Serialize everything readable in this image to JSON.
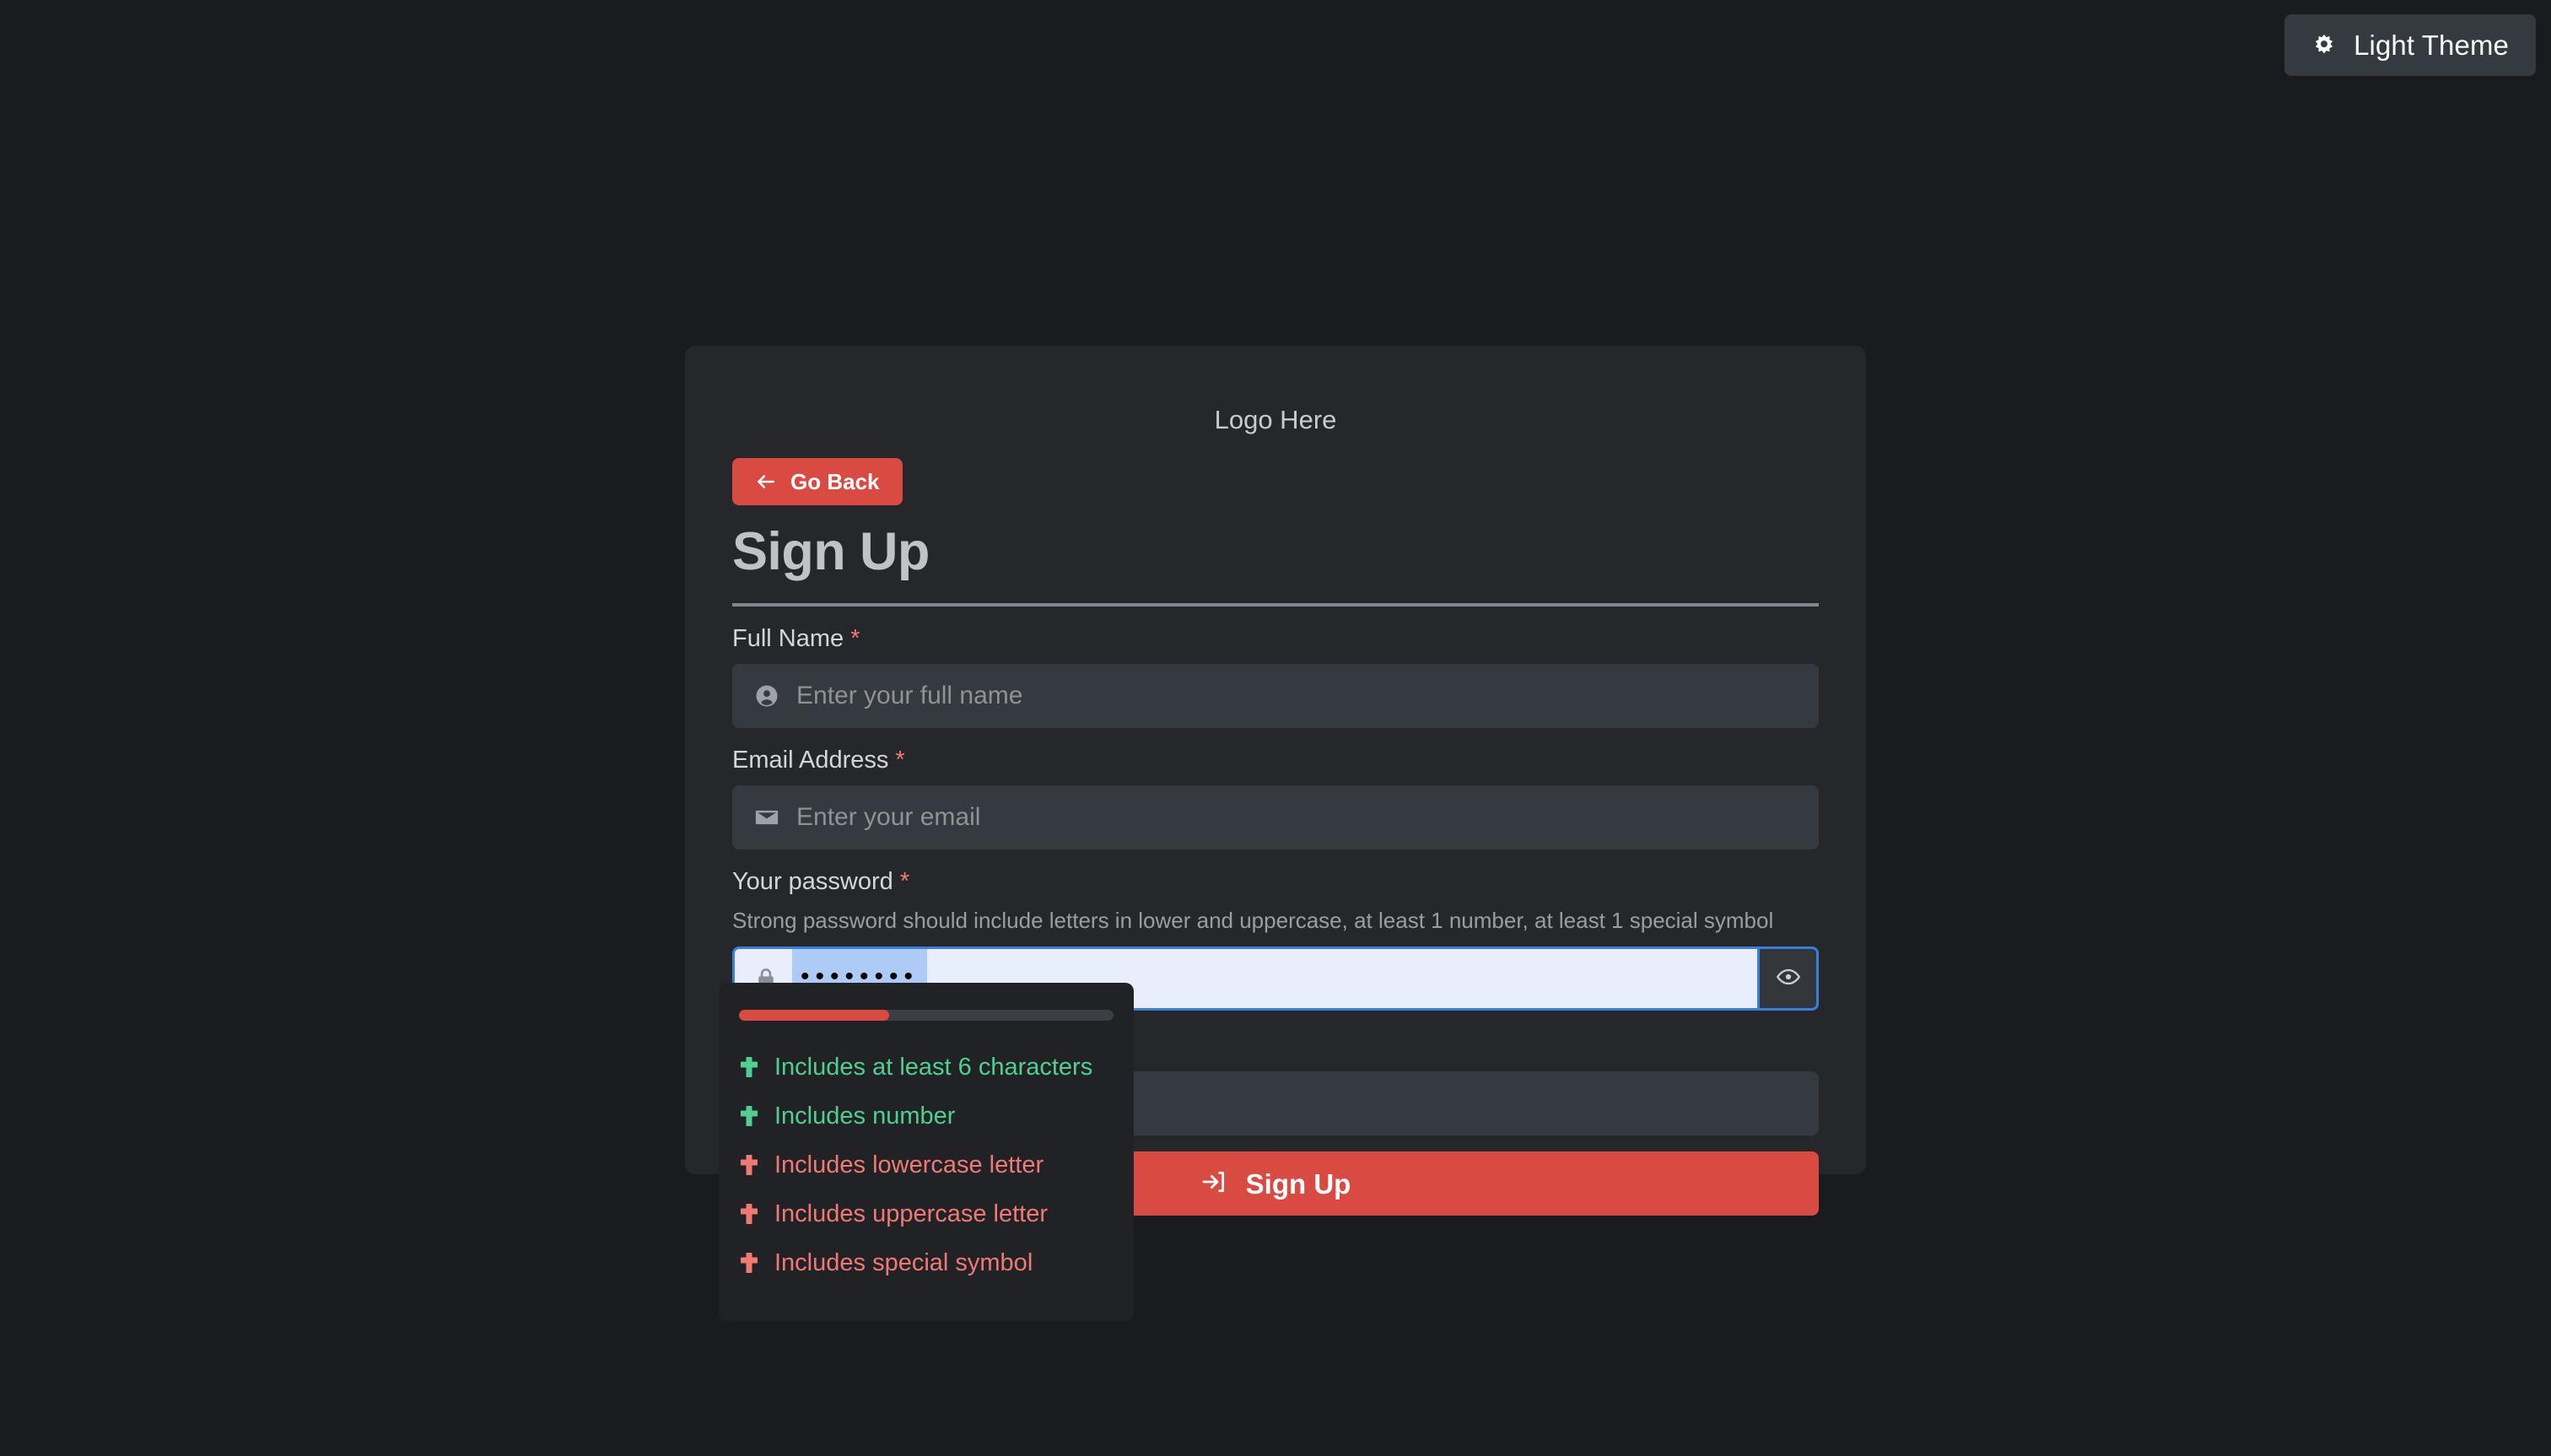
{
  "theme_toggle": {
    "label": "Light Theme",
    "icon": "sun-icon"
  },
  "card": {
    "logo_text": "Logo Here",
    "go_back_label": "Go Back",
    "go_back_icon": "arrow-left-icon",
    "title": "Sign Up"
  },
  "form": {
    "full_name": {
      "label": "Full Name",
      "required_marker": "*",
      "placeholder": "Enter your full name",
      "value": "",
      "icon": "user-circle-icon"
    },
    "email": {
      "label": "Email Address",
      "required_marker": "*",
      "placeholder": "Enter your email",
      "value": "",
      "icon": "envelope-icon"
    },
    "password": {
      "label": "Your password",
      "required_marker": "*",
      "hint": "Strong password should include letters in lower and uppercase, at least 1 number, at least 1 special symbol",
      "masked_value": "••••••••",
      "icon": "lock-icon",
      "toggle_icon": "eye-icon",
      "focused": true
    },
    "confirm_password": {
      "label": "",
      "placeholder": "",
      "value": ""
    },
    "submit": {
      "label": "Sign Up",
      "icon": "sign-in-icon"
    }
  },
  "password_strength": {
    "percent": 40,
    "bar_color": "#d94a42",
    "track_color": "#3b3f45",
    "requirements": [
      {
        "label": "Includes at least 6 characters",
        "met": true,
        "icon": "plus-icon"
      },
      {
        "label": "Includes number",
        "met": true,
        "icon": "plus-icon"
      },
      {
        "label": "Includes lowercase letter",
        "met": false,
        "icon": "plus-icon"
      },
      {
        "label": "Includes uppercase letter",
        "met": false,
        "icon": "plus-icon"
      },
      {
        "label": "Includes special symbol",
        "met": false,
        "icon": "plus-icon"
      }
    ]
  },
  "colors": {
    "page_background": "#1a1b1e",
    "card_background": "#26272b",
    "popover_background": "#212226",
    "accent_red": "#d94a42",
    "input_background": "#343a40",
    "focus_blue": "#3b7ddd",
    "success_green": "#51cf91",
    "error_red": "#ef7a75"
  }
}
